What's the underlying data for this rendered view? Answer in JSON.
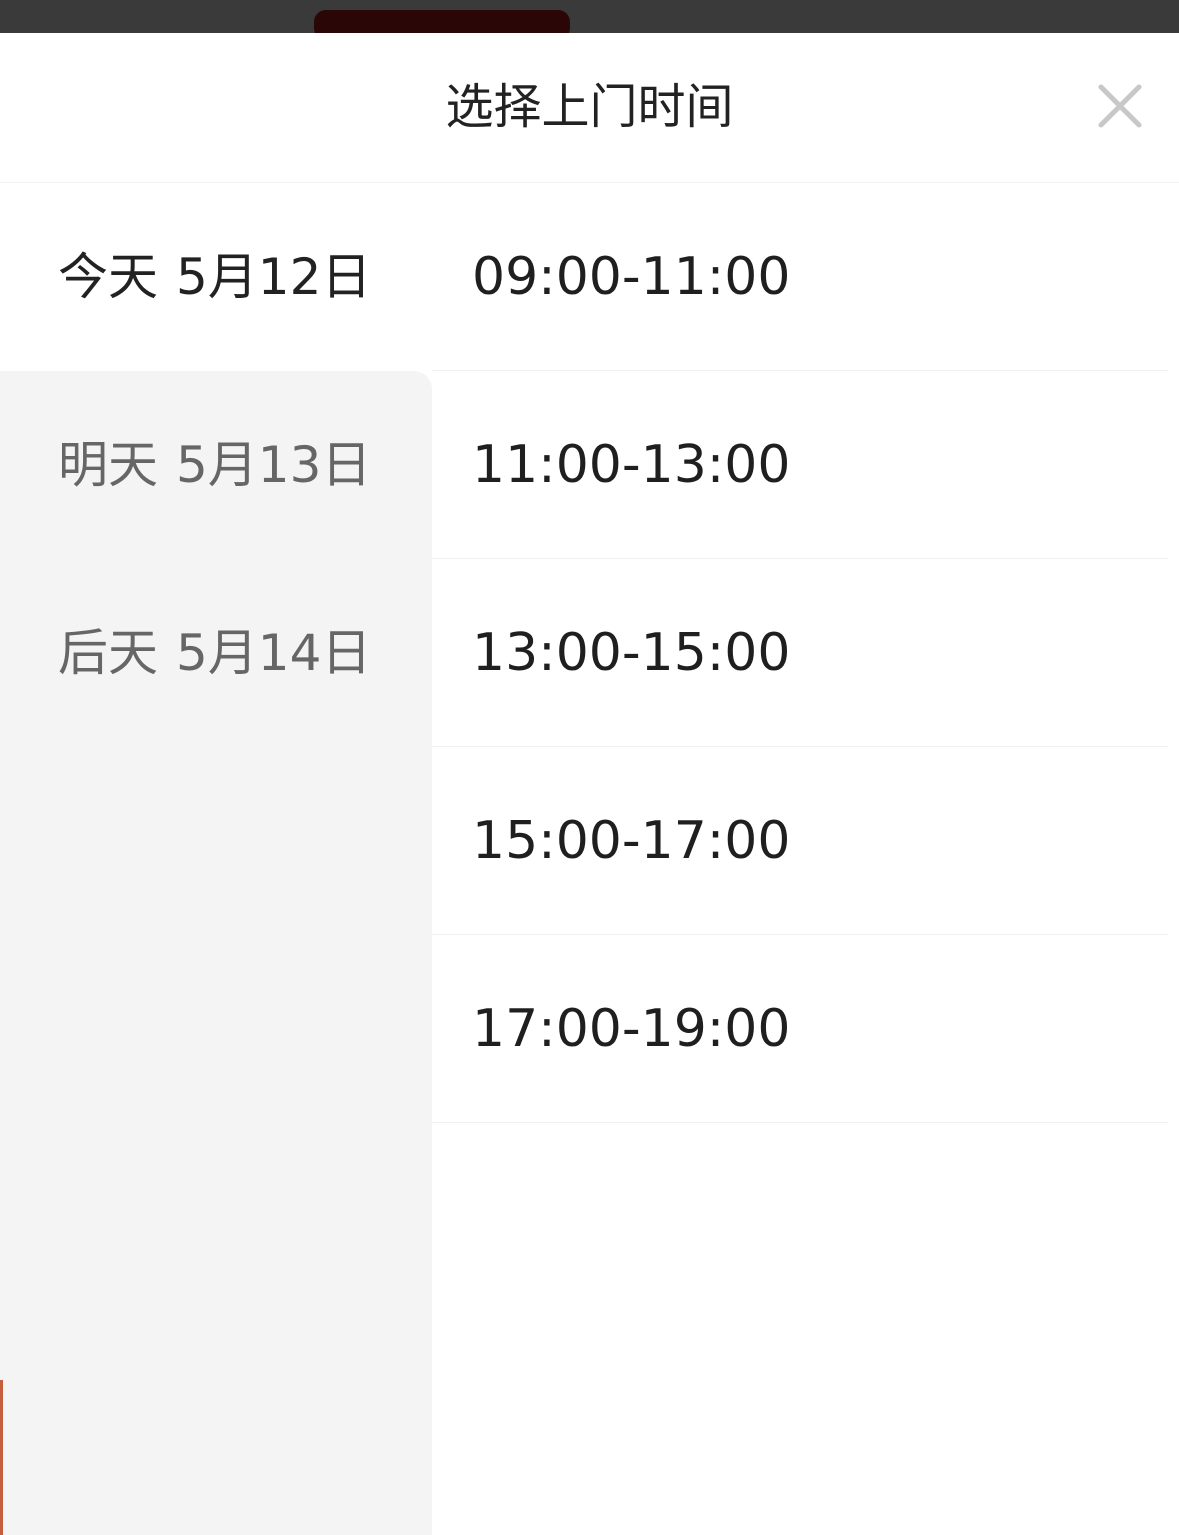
{
  "header": {
    "title": "选择上门时间"
  },
  "dates": [
    {
      "day_name": "今天",
      "date": "5月12日",
      "selected": true
    },
    {
      "day_name": "明天",
      "date": "5月13日",
      "selected": false
    },
    {
      "day_name": "后天",
      "date": "5月14日",
      "selected": false
    }
  ],
  "time_slots": [
    {
      "label": "09:00-11:00"
    },
    {
      "label": "11:00-13:00"
    },
    {
      "label": "13:00-15:00"
    },
    {
      "label": "15:00-17:00"
    },
    {
      "label": "17:00-19:00"
    }
  ],
  "colors": {
    "background": "#ffffff",
    "date_panel_bg": "#f4f4f4",
    "text_primary": "#222222",
    "text_secondary": "#666666",
    "close_icon": "#c8c8c8"
  },
  "icons": {
    "close": "close-icon"
  }
}
